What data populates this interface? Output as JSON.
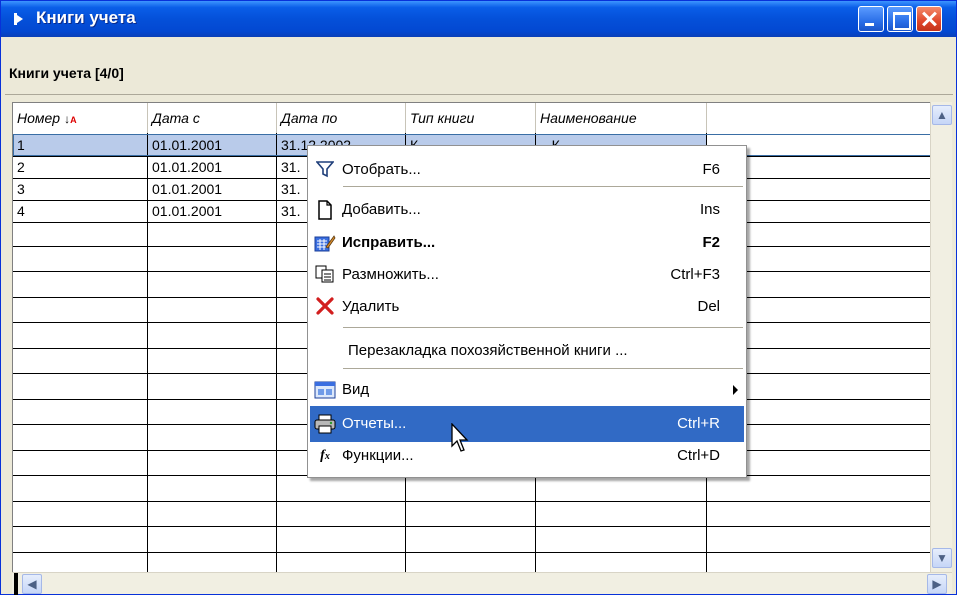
{
  "window": {
    "title": "Книги учета",
    "minimize": "Свернуть",
    "maximize": "Развернуть",
    "close": "Закрыть"
  },
  "panel": {
    "title": "Книги учета [4/0]"
  },
  "table": {
    "columns": [
      "Номер",
      "Дата с",
      "Дата по",
      "Тип книги",
      "Наименование"
    ],
    "sort_icon": "sort-az-icon",
    "rows": [
      [
        "1",
        "01.01.2001",
        "31.12.2002",
        "К...",
        "...К..."
      ],
      [
        "2",
        "01.01.2001",
        "31.",
        "",
        ""
      ],
      [
        "3",
        "01.01.2001",
        "31.",
        "",
        ""
      ],
      [
        "4",
        "01.01.2001",
        "31.",
        "",
        ""
      ]
    ]
  },
  "context_menu": {
    "items": [
      {
        "icon": "filter-icon",
        "label": "Отобрать...",
        "shortcut": "F6"
      },
      {
        "icon": "new-document-icon",
        "label": "Добавить...",
        "shortcut": "Ins"
      },
      {
        "icon": "edit-icon",
        "label": "Исправить...",
        "shortcut": "F2",
        "bold": true
      },
      {
        "icon": "copy-icon",
        "label": "Размножить...",
        "shortcut": "Ctrl+F3"
      },
      {
        "icon": "delete-x-icon",
        "label": "Удалить",
        "shortcut": "Del"
      },
      {
        "icon": "",
        "label": "Перезакладка похозяйственной книги ...",
        "shortcut": ""
      },
      {
        "icon": "view-icon",
        "label": "Вид",
        "shortcut": "",
        "submenu": true
      },
      {
        "icon": "printer-icon",
        "label": "Отчеты...",
        "shortcut": "Ctrl+R",
        "highlighted": true
      },
      {
        "icon": "function-icon",
        "label": "Функции...",
        "shortcut": "Ctrl+D"
      }
    ]
  },
  "colors": {
    "titlebar": "#0450d9",
    "selection": "#316ac5",
    "row_selected": "#b9cbea",
    "delete_icon": "#d21e1e"
  }
}
